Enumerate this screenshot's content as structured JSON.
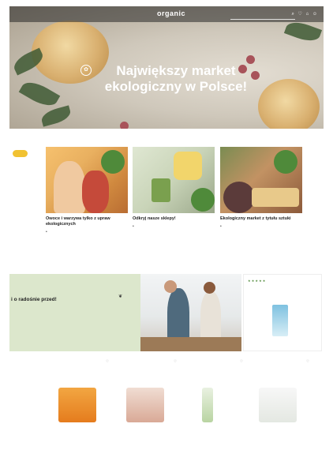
{
  "header": {
    "top_links": [
      "",
      "",
      ""
    ],
    "logo": "organic",
    "search_placeholder": "",
    "icons": [
      "search-icon",
      "heart-icon",
      "cart-icon",
      "user-icon"
    ],
    "categories": [
      "",
      ""
    ]
  },
  "hero": {
    "title": "Największy market ekologiczny w Polsce!"
  },
  "cards_chip": "",
  "cards": [
    {
      "title": "Owoce i warzywa tylko z upraw ekologicznych",
      "desc": "",
      "badge": ""
    },
    {
      "title": "Odkryj nasze sklepy!",
      "desc": "",
      "badge": ""
    },
    {
      "title": "Ekologiczny market z tytułu sztuki",
      "desc": "",
      "badge": ""
    }
  ],
  "promo": {
    "label": "",
    "title": "i o radośnie przed!",
    "text": ""
  },
  "side_product": {
    "name": "",
    "price": "",
    "cart": ""
  },
  "products": [
    {
      "tag": "",
      "name": "",
      "unit": "",
      "price": "",
      "cart": ""
    },
    {
      "tag": "",
      "name": "",
      "unit": "",
      "price": "",
      "cart": ""
    },
    {
      "tag": "",
      "name": "",
      "unit": "",
      "price": "",
      "cart": ""
    },
    {
      "tag": "",
      "name": "",
      "unit": "",
      "price": "",
      "cart": ""
    }
  ],
  "colors": {
    "accent": "#4f8a3a",
    "chip": "#f1c232",
    "promo_bg": "#dce7cc"
  }
}
